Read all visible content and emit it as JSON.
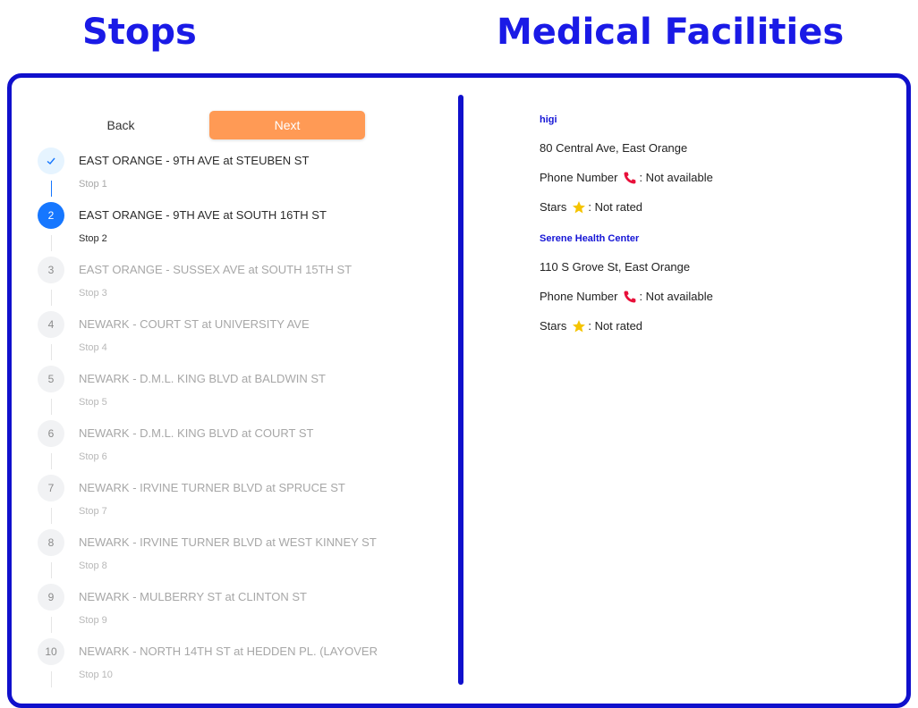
{
  "headings": {
    "stops": "Stops",
    "facilities": "Medical Facilities"
  },
  "nav": {
    "back_label": "Back",
    "next_label": "Next"
  },
  "steps": [
    {
      "status_mark": "✓",
      "title": "EAST ORANGE - 9TH AVE at STEUBEN ST",
      "sub": "Stop 1",
      "state": "done"
    },
    {
      "status_mark": "2",
      "title": "EAST ORANGE - 9TH AVE at SOUTH 16TH ST",
      "sub": "Stop 2",
      "state": "active"
    },
    {
      "status_mark": "3",
      "title": "EAST ORANGE - SUSSEX AVE at SOUTH 15TH ST",
      "sub": "Stop 3",
      "state": "wait"
    },
    {
      "status_mark": "4",
      "title": "NEWARK - COURT ST at UNIVERSITY AVE",
      "sub": "Stop 4",
      "state": "wait"
    },
    {
      "status_mark": "5",
      "title": "NEWARK - D.M.L. KING BLVD at BALDWIN ST",
      "sub": "Stop 5",
      "state": "wait"
    },
    {
      "status_mark": "6",
      "title": "NEWARK - D.M.L. KING BLVD at COURT ST",
      "sub": "Stop 6",
      "state": "wait"
    },
    {
      "status_mark": "7",
      "title": "NEWARK - IRVINE TURNER BLVD at SPRUCE ST",
      "sub": "Stop 7",
      "state": "wait"
    },
    {
      "status_mark": "8",
      "title": "NEWARK - IRVINE TURNER BLVD at WEST KINNEY ST",
      "sub": "Stop 8",
      "state": "wait"
    },
    {
      "status_mark": "9",
      "title": "NEWARK - MULBERRY ST at CLINTON ST",
      "sub": "Stop 9",
      "state": "wait"
    },
    {
      "status_mark": "10",
      "title": "NEWARK - NORTH 14TH ST at HEDDEN PL. (LAYOVER",
      "sub": "Stop 10",
      "state": "wait"
    }
  ],
  "facilities": [
    {
      "name": "higi",
      "address": "80 Central Ave, East Orange",
      "phone_label": "Phone Number",
      "phone_value": ": Not available",
      "stars_label": "Stars",
      "stars_value": ": Not rated"
    },
    {
      "name": "Serene Health Center",
      "address": "110 S Grove St, East Orange",
      "phone_label": "Phone Number",
      "phone_value": ": Not available",
      "stars_label": "Stars",
      "stars_value": ": Not rated"
    }
  ],
  "icons": {
    "phone": "phone-icon",
    "star": "star-icon",
    "check": "check-icon"
  },
  "colors": {
    "heading": "#1a1ae6",
    "frame": "#1010cc",
    "next_button": "#ff9a55",
    "step_active": "#1677ff",
    "facility_name": "#1515d6",
    "phone_icon": "#e8103a",
    "star_icon": "#f5c400"
  }
}
